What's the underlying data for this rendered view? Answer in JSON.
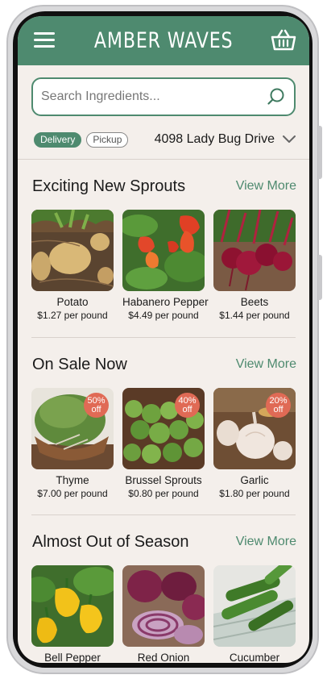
{
  "header": {
    "brand": "AMBER WAVES",
    "menu_icon": "hamburger-menu-icon",
    "cart_icon": "basket-icon"
  },
  "search": {
    "placeholder": "Search Ingredients...",
    "value": ""
  },
  "fulfillment": {
    "options": [
      {
        "label": "Delivery",
        "active": true
      },
      {
        "label": "Pickup",
        "active": false
      }
    ],
    "address": "4098 Lady Bug Drive"
  },
  "sections": [
    {
      "title": "Exciting New Sprouts",
      "view_more": "View More",
      "items": [
        {
          "name": "Potato",
          "price": "$1.27 per pound"
        },
        {
          "name": "Habanero Pepper",
          "price": "$4.49 per pound"
        },
        {
          "name": "Beets",
          "price": "$1.44 per pound"
        }
      ]
    },
    {
      "title": "On Sale Now",
      "view_more": "View More",
      "items": [
        {
          "name": "Thyme",
          "price": "$7.00 per pound",
          "discount_pct": "50%",
          "discount_label": "off"
        },
        {
          "name": "Brussel Sprouts",
          "price": "$0.80 per pound",
          "discount_pct": "40%",
          "discount_label": "off"
        },
        {
          "name": "Garlic",
          "price": "$1.80 per pound",
          "discount_pct": "20%",
          "discount_label": "off"
        }
      ]
    },
    {
      "title": "Almost Out of Season",
      "view_more": "View More",
      "items": [
        {
          "name": "Bell Pepper",
          "price": ""
        },
        {
          "name": "Red Onion",
          "price": ""
        },
        {
          "name": "Cucumber",
          "price": ""
        }
      ]
    }
  ],
  "colors": {
    "brand_green": "#4e8a6f",
    "background": "#f4efeb",
    "sale_badge": "#e06a55"
  }
}
